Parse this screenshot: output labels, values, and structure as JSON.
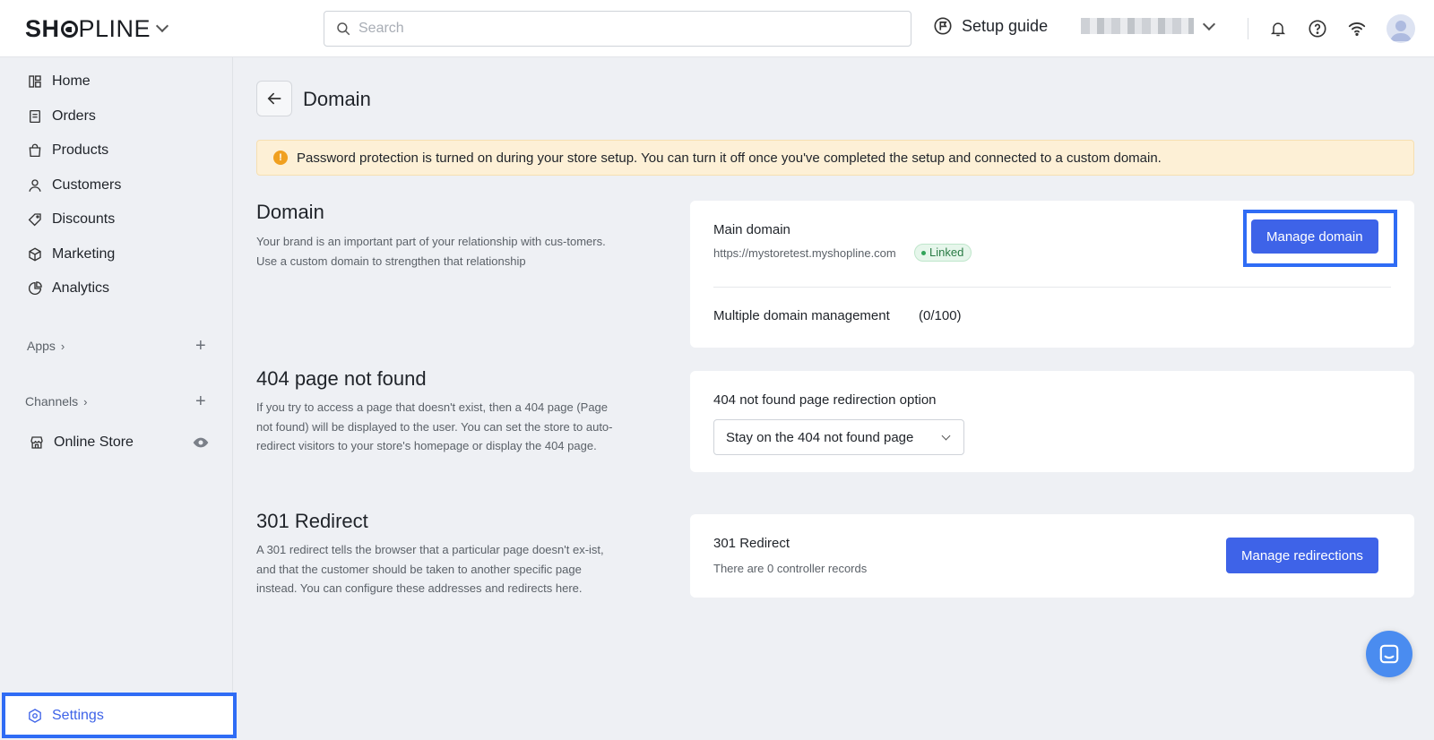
{
  "header": {
    "logo": {
      "pre": "SH",
      "post": "PLINE"
    },
    "search_placeholder": "Search",
    "setup_guide": "Setup guide"
  },
  "sidebar": {
    "items": [
      {
        "label": "Home",
        "icon": "home-icon"
      },
      {
        "label": "Orders",
        "icon": "orders-icon"
      },
      {
        "label": "Products",
        "icon": "products-icon"
      },
      {
        "label": "Customers",
        "icon": "customers-icon"
      },
      {
        "label": "Discounts",
        "icon": "discounts-icon"
      },
      {
        "label": "Marketing",
        "icon": "marketing-icon"
      },
      {
        "label": "Analytics",
        "icon": "analytics-icon"
      }
    ],
    "apps_label": "Apps",
    "channels_label": "Channels",
    "online_store": "Online Store",
    "settings": "Settings"
  },
  "page": {
    "title": "Domain",
    "notice": "Password protection is turned on during your store setup. You can turn it off once you've completed the setup and connected to a custom domain."
  },
  "domain_section": {
    "title": "Domain",
    "description": "Your brand is an important part of your relationship with cus-tomers. Use a custom domain to strengthen that relationship",
    "main_domain_label": "Main domain",
    "main_domain_url": "https://mystoretest.myshopline.com",
    "status": "Linked",
    "manage_button": "Manage domain",
    "multiple_label": "Multiple domain management",
    "multiple_count": "(0/100)"
  },
  "not_found_section": {
    "title": "404 page not found",
    "description": "If you try to access a page that doesn't exist, then a 404 page (Page not found) will be displayed to the user. You can set the store to auto-redirect visitors to your store's homepage or display the 404 page.",
    "option_label": "404 not found page redirection option",
    "selected": "Stay on the 404 not found page"
  },
  "redirect_section": {
    "title": "301 Redirect",
    "description": "A 301 redirect tells the browser that a particular page doesn't ex-ist, and that the customer should be taken to another specific page instead. You can configure these addresses and redirects here.",
    "card_title": "301 Redirect",
    "records": "There are 0 controller records",
    "manage_button": "Manage redirections"
  },
  "colors": {
    "accent": "#3e63e8",
    "highlight": "#2f6cf5",
    "notice_bg": "#fdf0d6",
    "linked": "#2a7b45"
  }
}
